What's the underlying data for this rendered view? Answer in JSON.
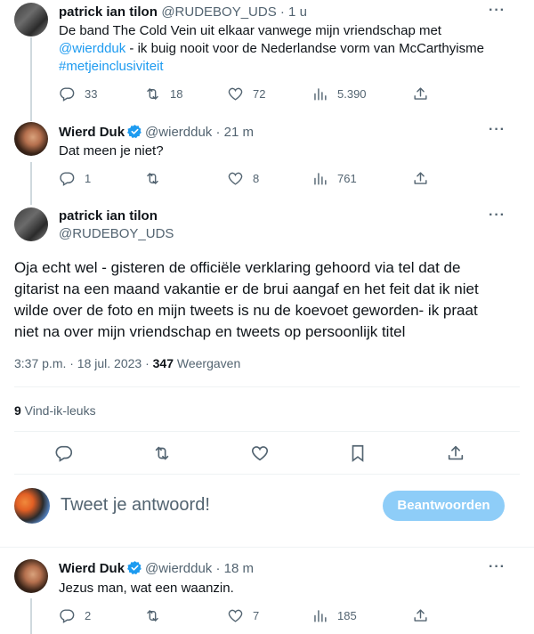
{
  "tweet1": {
    "name": "patrick ian tilon",
    "handle_time": "@RUDEBOY_UDS · 1 u",
    "text_line1": "De band The Cold Vein uit elkaar vanwege mijn vriendschap met",
    "mention": "@wierdduk",
    "text_line2_rest": " - ik buig nooit voor de Nederlandse vorm van McCarthyisme",
    "hashtag": "#metjeinclusiviteit",
    "replies": "33",
    "retweets": "18",
    "likes": "72",
    "views": "5.390"
  },
  "tweet2": {
    "name": "Wierd Duk",
    "handle_time": "@wierdduk · 21 m",
    "text": "Dat meen je niet?",
    "replies": "1",
    "retweets": "",
    "likes": "8",
    "views": "761"
  },
  "main_tweet": {
    "name": "patrick ian tilon",
    "handle": "@RUDEBOY_UDS",
    "text": "Oja echt wel - gisteren de officiële verklaring gehoord via tel dat de gitarist na een maand vakantie er de brui aangaf en het feit dat ik niet wilde over de foto en mijn tweets is nu de koevoet geworden- ik praat niet na over mijn vriendschap en tweets op persoonlijk titel",
    "timestamp": "3:37 p.m. · 18 jul. 2023 · ",
    "views_count": "347",
    "views_label": " Weergaven",
    "likes_count": "9",
    "likes_label": " Vind-ik-leuks"
  },
  "compose": {
    "placeholder": "Tweet je antwoord!",
    "button": "Beantwoorden"
  },
  "tweet3": {
    "name": "Wierd Duk",
    "handle_time": "@wierdduk · 18 m",
    "text": "Jezus man, wat een waanzin.",
    "replies": "2",
    "retweets": "",
    "likes": "7",
    "views": "185"
  },
  "colors": {
    "accent": "#1d9bf0",
    "muted": "#536471",
    "button_disabled": "#8ecdf8"
  }
}
